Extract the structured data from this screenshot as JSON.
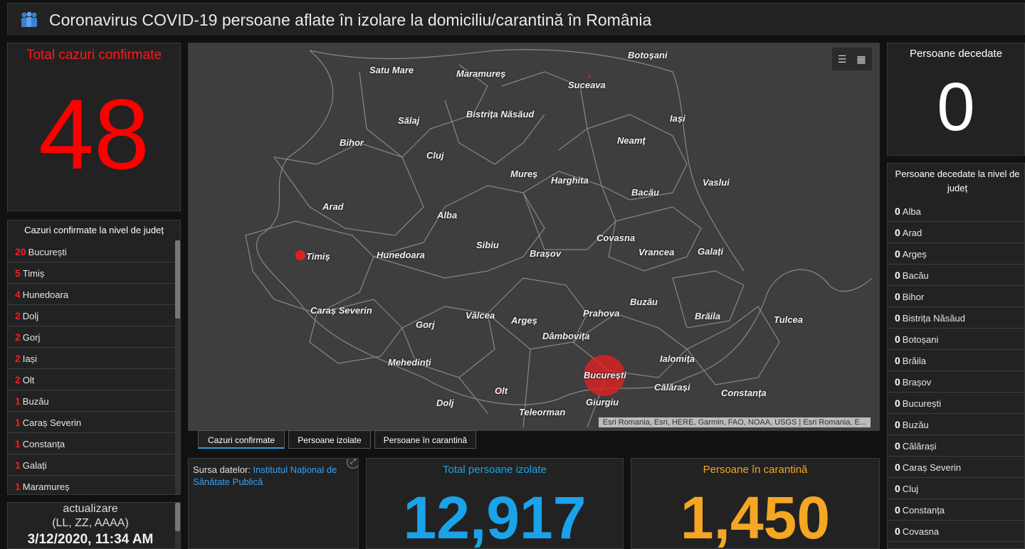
{
  "header": {
    "title": "Coronavirus COVID-19 persoane aflate în izolare la domiciliu/carantină în România",
    "logo_icon": "people-logo-icon"
  },
  "total_cases": {
    "label": "Total cazuri confirmate",
    "value": "48",
    "color": "#ff0000"
  },
  "county_cases": {
    "title": "Cazuri confirmate la nivel de județ",
    "rows": [
      {
        "count": "20",
        "name": "București"
      },
      {
        "count": "5",
        "name": "Timiș"
      },
      {
        "count": "4",
        "name": "Hunedoara"
      },
      {
        "count": "2",
        "name": "Dolj"
      },
      {
        "count": "2",
        "name": "Gorj"
      },
      {
        "count": "2",
        "name": "Iași"
      },
      {
        "count": "2",
        "name": "Olt"
      },
      {
        "count": "1",
        "name": "Buzău"
      },
      {
        "count": "1",
        "name": "Caraș Severin"
      },
      {
        "count": "1",
        "name": "Constanța"
      },
      {
        "count": "1",
        "name": "Galați"
      },
      {
        "count": "1",
        "name": "Maramureș"
      }
    ]
  },
  "update": {
    "label": "actualizare",
    "format": "(LL, ZZ, AAAA)",
    "value": "3/12/2020, 11:34 AM"
  },
  "map": {
    "attribution": "Esri Romania, Esri, HERE, Garmin, FAO, NOAA, USGS | Esri Romania, E...",
    "labels": [
      {
        "name": "Botoșani"
      },
      {
        "name": "Satu Mare"
      },
      {
        "name": "Maramureș"
      },
      {
        "name": "Suceava"
      },
      {
        "name": "Sălaj"
      },
      {
        "name": "Bistrița Năsăud"
      },
      {
        "name": "Iași"
      },
      {
        "name": "Bihor"
      },
      {
        "name": "Cluj"
      },
      {
        "name": "Neamț"
      },
      {
        "name": "Mureș"
      },
      {
        "name": "Harghita"
      },
      {
        "name": "Bacău"
      },
      {
        "name": "Vaslui"
      },
      {
        "name": "Arad"
      },
      {
        "name": "Alba"
      },
      {
        "name": "Sibiu"
      },
      {
        "name": "Covasna"
      },
      {
        "name": "Timiș"
      },
      {
        "name": "Hunedoara"
      },
      {
        "name": "Brașov"
      },
      {
        "name": "Vrancea"
      },
      {
        "name": "Galați"
      },
      {
        "name": "Buzău"
      },
      {
        "name": "Caraș Severin"
      },
      {
        "name": "Prahova"
      },
      {
        "name": "Vâlcea"
      },
      {
        "name": "Argeș"
      },
      {
        "name": "Brăila"
      },
      {
        "name": "Tulcea"
      },
      {
        "name": "Gorj"
      },
      {
        "name": "Dâmbovița"
      },
      {
        "name": "Ialomița"
      },
      {
        "name": "Mehedinți"
      },
      {
        "name": "București"
      },
      {
        "name": "Olt"
      },
      {
        "name": "Călărași"
      },
      {
        "name": "Constanța"
      },
      {
        "name": "Dolj"
      },
      {
        "name": "Giurgiu"
      },
      {
        "name": "Teleorman"
      }
    ],
    "marker_color": "#e02020",
    "buttons": {
      "legend_icon": "legend-list-icon",
      "basemap_icon": "basemap-gallery-icon"
    }
  },
  "tabs": [
    {
      "label": "Cazuri confirmate",
      "active": true
    },
    {
      "label": "Persoane izolate",
      "active": false
    },
    {
      "label": "Persoane în carantină",
      "active": false
    }
  ],
  "source": {
    "prefix": "Sursa datelor: ",
    "link": "Institutul Național de Sănătate Publică",
    "expand_icon": "expand-icon"
  },
  "isolated": {
    "label": "Total persoane izolate",
    "value": "12,917",
    "color": "#1aa3ea"
  },
  "quarantine": {
    "label": "Persoane în carantină",
    "value": "1,450",
    "color": "#f5a623"
  },
  "deceased": {
    "label": "Persoane decedate",
    "value": "0"
  },
  "deceased_by_county": {
    "title": "Persoane decedate la nivel de județ",
    "rows": [
      {
        "count": "0",
        "name": "Alba"
      },
      {
        "count": "0",
        "name": "Arad"
      },
      {
        "count": "0",
        "name": "Argeș"
      },
      {
        "count": "0",
        "name": "Bacău"
      },
      {
        "count": "0",
        "name": "Bihor"
      },
      {
        "count": "0",
        "name": "Bistrița Năsăud"
      },
      {
        "count": "0",
        "name": "Botoșani"
      },
      {
        "count": "0",
        "name": "Brăila"
      },
      {
        "count": "0",
        "name": "Brașov"
      },
      {
        "count": "0",
        "name": "București"
      },
      {
        "count": "0",
        "name": "Buzău"
      },
      {
        "count": "0",
        "name": "Călărași"
      },
      {
        "count": "0",
        "name": "Caraș Severin"
      },
      {
        "count": "0",
        "name": "Cluj"
      },
      {
        "count": "0",
        "name": "Constanța"
      },
      {
        "count": "0",
        "name": "Covasna"
      }
    ]
  }
}
